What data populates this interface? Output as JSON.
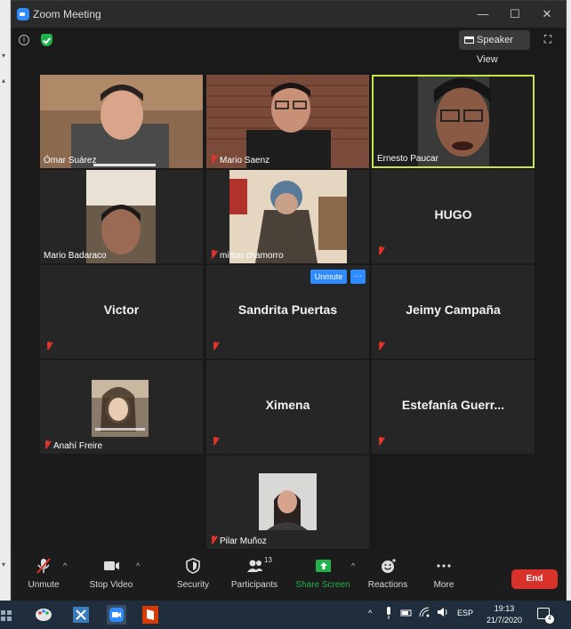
{
  "window": {
    "title": "Zoom Meeting",
    "minimize": "—",
    "maximize": "☐",
    "close": "✕"
  },
  "topbar": {
    "speaker_view": "Speaker View"
  },
  "participants": [
    {
      "name": "Ómar Suárez"
    },
    {
      "name": "Mario Saenz"
    },
    {
      "name": "Ernesto Paucar"
    },
    {
      "name": "Mario Badaraco"
    },
    {
      "name": "milton chamorro"
    },
    {
      "name": "HUGO"
    },
    {
      "name": "Victor"
    },
    {
      "name": "Sandrita Puertas"
    },
    {
      "name": "Jeimy Campaña"
    },
    {
      "name": "Anahí Freire"
    },
    {
      "name": "Ximena"
    },
    {
      "name": "Estefanía  Guerr..."
    },
    {
      "name": "Pilar Muñoz"
    }
  ],
  "hover_controls": {
    "unmute": "Unmute",
    "more": "···"
  },
  "toolbar": {
    "unmute": "Unmute",
    "stop_video": "Stop Video",
    "security": "Security",
    "participants": "Participants",
    "participants_count": "13",
    "share_screen": "Share Screen",
    "reactions": "Reactions",
    "more": "More",
    "end": "End"
  },
  "taskbar": {
    "language": "ESP",
    "time": "19:13",
    "date": "21/7/2020",
    "notifications": "4"
  },
  "colors": {
    "accent": "#2d8cff",
    "end": "#d8322b",
    "share": "#23b14d",
    "active_border": "#c5e64a",
    "muted": "#e0352b"
  }
}
